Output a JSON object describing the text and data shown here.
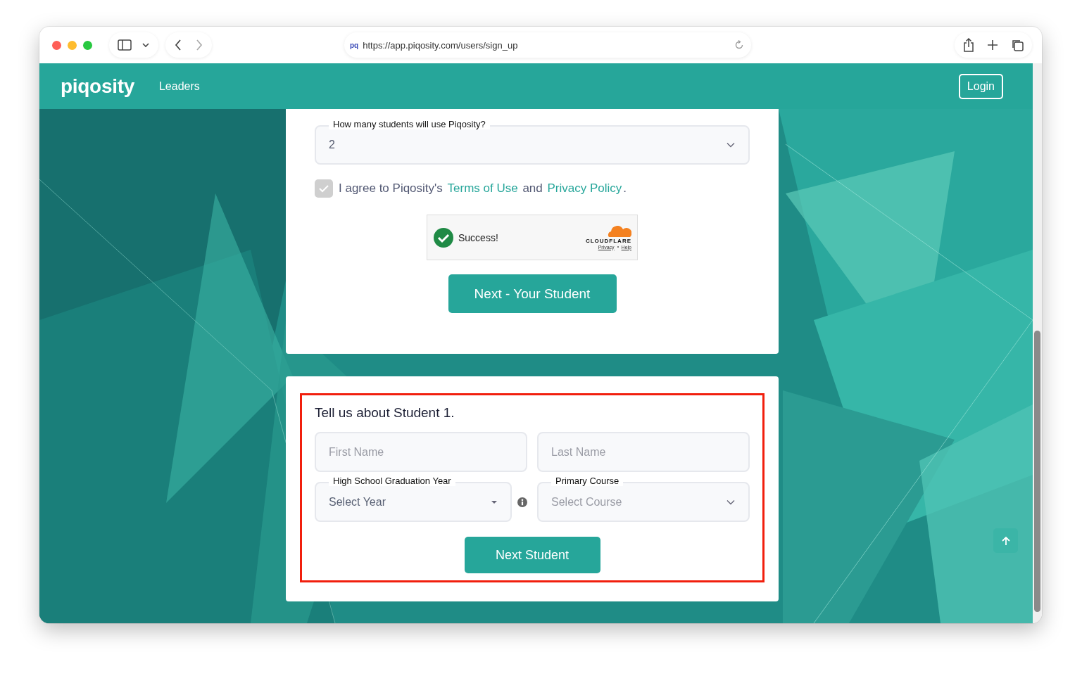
{
  "browser": {
    "favicon_text": "pq",
    "url": "https://app.piqosity.com/users/sign_up"
  },
  "navbar": {
    "logo": "piqosity",
    "links": [
      "Leaders"
    ],
    "login": "Login"
  },
  "signup_form": {
    "student_count": {
      "label": "How many students will use Piqosity?",
      "value": "2"
    },
    "agreement": {
      "checked": true,
      "prefix": "I agree to Piqosity's",
      "terms_link": "Terms of Use",
      "joiner": "and",
      "privacy_link": "Privacy Policy",
      "suffix": "."
    },
    "captcha": {
      "status": "Success!",
      "brand": "CLOUDFLARE",
      "links": [
        "Privacy",
        "Help"
      ]
    },
    "next_button": "Next - Your Student"
  },
  "student_form": {
    "highlighted": true,
    "title": "Tell us about Student 1.",
    "first_name": {
      "placeholder": "First Name"
    },
    "last_name": {
      "placeholder": "Last Name"
    },
    "grad_year": {
      "label": "High School Graduation Year",
      "value": "Select Year"
    },
    "course": {
      "label": "Primary Course",
      "placeholder": "Select Course"
    },
    "next_button": "Next Student"
  }
}
